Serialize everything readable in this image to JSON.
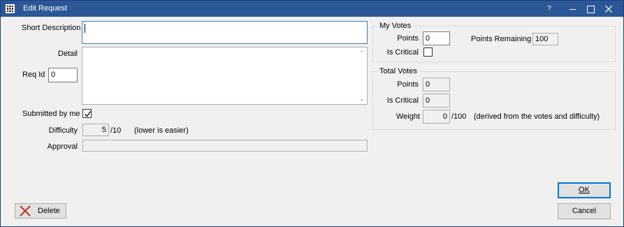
{
  "window": {
    "title": "Edit Request",
    "help": "?"
  },
  "left": {
    "short_description_label": "Short Description",
    "short_description_value": "",
    "detail_label": "Detail",
    "detail_value": "",
    "req_id_label": "Req Id",
    "req_id_value": "0",
    "submitted_by_me_label": "Submitted by me",
    "submitted_by_me_checked": true,
    "difficulty_label": "Difficulty",
    "difficulty_value": "5",
    "difficulty_suffix": "/10",
    "difficulty_hint": "(lower is easier)",
    "approval_label": "Approval",
    "approval_value": ""
  },
  "my_votes": {
    "title": "My Votes",
    "points_label": "Points",
    "points_value": "0",
    "points_remaining_label": "Points Remaining",
    "points_remaining_value": "100",
    "is_critical_label": "Is Critical",
    "is_critical_checked": false
  },
  "total_votes": {
    "title": "Total Votes",
    "points_label": "Points",
    "points_value": "0",
    "is_critical_label": "Is Critical",
    "is_critical_value": "0",
    "weight_label": "Weight",
    "weight_value": "0",
    "weight_suffix": "/100",
    "weight_hint": "(derived from the votes and difficulty)"
  },
  "buttons": {
    "delete_label": "Delete",
    "ok_label": "OK",
    "cancel_label": "Cancel"
  },
  "colors": {
    "titlebar": "#2b5797",
    "focus_border": "#3c7fb1",
    "delete_icon": "#c0392b"
  }
}
